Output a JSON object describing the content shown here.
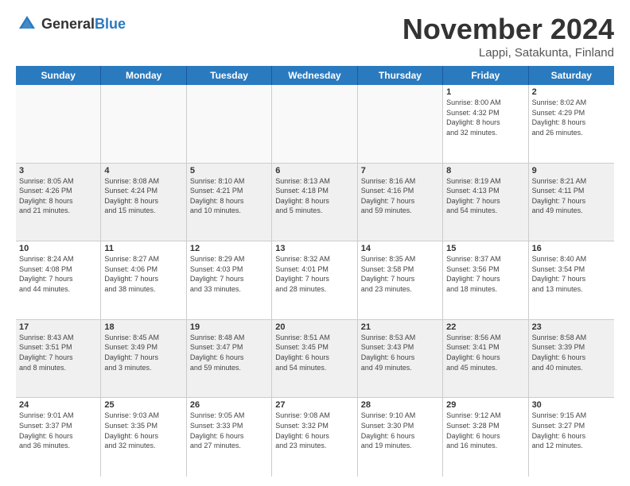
{
  "logo": {
    "general": "General",
    "blue": "Blue"
  },
  "header": {
    "month": "November 2024",
    "location": "Lappi, Satakunta, Finland"
  },
  "weekdays": [
    "Sunday",
    "Monday",
    "Tuesday",
    "Wednesday",
    "Thursday",
    "Friday",
    "Saturday"
  ],
  "weeks": [
    [
      {
        "day": "",
        "info": "",
        "empty": true
      },
      {
        "day": "",
        "info": "",
        "empty": true
      },
      {
        "day": "",
        "info": "",
        "empty": true
      },
      {
        "day": "",
        "info": "",
        "empty": true
      },
      {
        "day": "",
        "info": "",
        "empty": true
      },
      {
        "day": "1",
        "info": "Sunrise: 8:00 AM\nSunset: 4:32 PM\nDaylight: 8 hours\nand 32 minutes.",
        "empty": false
      },
      {
        "day": "2",
        "info": "Sunrise: 8:02 AM\nSunset: 4:29 PM\nDaylight: 8 hours\nand 26 minutes.",
        "empty": false
      }
    ],
    [
      {
        "day": "3",
        "info": "Sunrise: 8:05 AM\nSunset: 4:26 PM\nDaylight: 8 hours\nand 21 minutes.",
        "empty": false
      },
      {
        "day": "4",
        "info": "Sunrise: 8:08 AM\nSunset: 4:24 PM\nDaylight: 8 hours\nand 15 minutes.",
        "empty": false
      },
      {
        "day": "5",
        "info": "Sunrise: 8:10 AM\nSunset: 4:21 PM\nDaylight: 8 hours\nand 10 minutes.",
        "empty": false
      },
      {
        "day": "6",
        "info": "Sunrise: 8:13 AM\nSunset: 4:18 PM\nDaylight: 8 hours\nand 5 minutes.",
        "empty": false
      },
      {
        "day": "7",
        "info": "Sunrise: 8:16 AM\nSunset: 4:16 PM\nDaylight: 7 hours\nand 59 minutes.",
        "empty": false
      },
      {
        "day": "8",
        "info": "Sunrise: 8:19 AM\nSunset: 4:13 PM\nDaylight: 7 hours\nand 54 minutes.",
        "empty": false
      },
      {
        "day": "9",
        "info": "Sunrise: 8:21 AM\nSunset: 4:11 PM\nDaylight: 7 hours\nand 49 minutes.",
        "empty": false
      }
    ],
    [
      {
        "day": "10",
        "info": "Sunrise: 8:24 AM\nSunset: 4:08 PM\nDaylight: 7 hours\nand 44 minutes.",
        "empty": false
      },
      {
        "day": "11",
        "info": "Sunrise: 8:27 AM\nSunset: 4:06 PM\nDaylight: 7 hours\nand 38 minutes.",
        "empty": false
      },
      {
        "day": "12",
        "info": "Sunrise: 8:29 AM\nSunset: 4:03 PM\nDaylight: 7 hours\nand 33 minutes.",
        "empty": false
      },
      {
        "day": "13",
        "info": "Sunrise: 8:32 AM\nSunset: 4:01 PM\nDaylight: 7 hours\nand 28 minutes.",
        "empty": false
      },
      {
        "day": "14",
        "info": "Sunrise: 8:35 AM\nSunset: 3:58 PM\nDaylight: 7 hours\nand 23 minutes.",
        "empty": false
      },
      {
        "day": "15",
        "info": "Sunrise: 8:37 AM\nSunset: 3:56 PM\nDaylight: 7 hours\nand 18 minutes.",
        "empty": false
      },
      {
        "day": "16",
        "info": "Sunrise: 8:40 AM\nSunset: 3:54 PM\nDaylight: 7 hours\nand 13 minutes.",
        "empty": false
      }
    ],
    [
      {
        "day": "17",
        "info": "Sunrise: 8:43 AM\nSunset: 3:51 PM\nDaylight: 7 hours\nand 8 minutes.",
        "empty": false
      },
      {
        "day": "18",
        "info": "Sunrise: 8:45 AM\nSunset: 3:49 PM\nDaylight: 7 hours\nand 3 minutes.",
        "empty": false
      },
      {
        "day": "19",
        "info": "Sunrise: 8:48 AM\nSunset: 3:47 PM\nDaylight: 6 hours\nand 59 minutes.",
        "empty": false
      },
      {
        "day": "20",
        "info": "Sunrise: 8:51 AM\nSunset: 3:45 PM\nDaylight: 6 hours\nand 54 minutes.",
        "empty": false
      },
      {
        "day": "21",
        "info": "Sunrise: 8:53 AM\nSunset: 3:43 PM\nDaylight: 6 hours\nand 49 minutes.",
        "empty": false
      },
      {
        "day": "22",
        "info": "Sunrise: 8:56 AM\nSunset: 3:41 PM\nDaylight: 6 hours\nand 45 minutes.",
        "empty": false
      },
      {
        "day": "23",
        "info": "Sunrise: 8:58 AM\nSunset: 3:39 PM\nDaylight: 6 hours\nand 40 minutes.",
        "empty": false
      }
    ],
    [
      {
        "day": "24",
        "info": "Sunrise: 9:01 AM\nSunset: 3:37 PM\nDaylight: 6 hours\nand 36 minutes.",
        "empty": false
      },
      {
        "day": "25",
        "info": "Sunrise: 9:03 AM\nSunset: 3:35 PM\nDaylight: 6 hours\nand 32 minutes.",
        "empty": false
      },
      {
        "day": "26",
        "info": "Sunrise: 9:05 AM\nSunset: 3:33 PM\nDaylight: 6 hours\nand 27 minutes.",
        "empty": false
      },
      {
        "day": "27",
        "info": "Sunrise: 9:08 AM\nSunset: 3:32 PM\nDaylight: 6 hours\nand 23 minutes.",
        "empty": false
      },
      {
        "day": "28",
        "info": "Sunrise: 9:10 AM\nSunset: 3:30 PM\nDaylight: 6 hours\nand 19 minutes.",
        "empty": false
      },
      {
        "day": "29",
        "info": "Sunrise: 9:12 AM\nSunset: 3:28 PM\nDaylight: 6 hours\nand 16 minutes.",
        "empty": false
      },
      {
        "day": "30",
        "info": "Sunrise: 9:15 AM\nSunset: 3:27 PM\nDaylight: 6 hours\nand 12 minutes.",
        "empty": false
      }
    ]
  ]
}
